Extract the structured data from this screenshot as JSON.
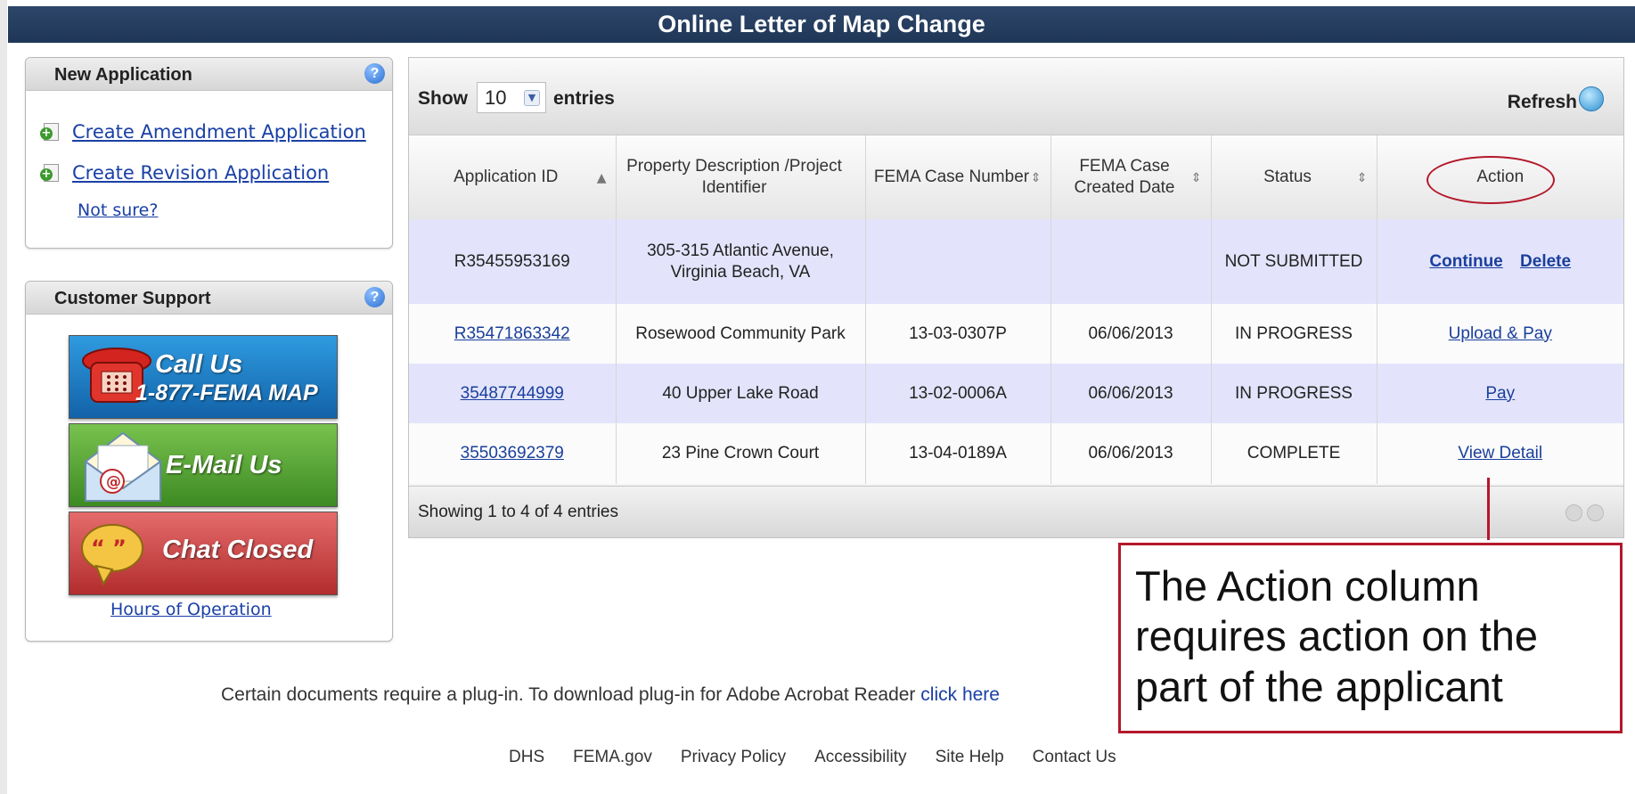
{
  "header": {
    "title": "Online Letter of Map Change"
  },
  "new_application": {
    "title": "New Application",
    "help": "?",
    "links": [
      "Create Amendment Application",
      "Create Revision Application"
    ],
    "not_sure": "Not sure?"
  },
  "customer_support": {
    "title": "Customer Support",
    "help": "?",
    "call_label": "Call Us",
    "call_number": "1-877-FEMA MAP",
    "email_label": "E-Mail Us",
    "chat_label": "Chat Closed",
    "hours_link": "Hours of Operation"
  },
  "grid": {
    "show_label": "Show",
    "entries_value": "10",
    "entries_label": "entries",
    "refresh_label": "Refresh",
    "columns": [
      "Application ID",
      "Property Description /Project Identifier",
      "FEMA Case Number",
      "FEMA Case Created Date",
      "Status",
      "Action"
    ],
    "rows": [
      {
        "id": "R35455953169",
        "property": "305-315 Atlantic Avenue, Virginia Beach, VA",
        "case_number": "",
        "created": "",
        "status": "NOT SUBMITTED",
        "actions": [
          "Continue",
          "Delete"
        ]
      },
      {
        "id": "R35471863342",
        "property": "Rosewood Community Park",
        "case_number": "13-03-0307P",
        "created": "06/06/2013",
        "status": "IN PROGRESS",
        "actions": [
          "Upload & Pay"
        ]
      },
      {
        "id": "35487744999",
        "property": "40 Upper Lake Road",
        "case_number": "13-02-0006A",
        "created": "06/06/2013",
        "status": "IN PROGRESS",
        "actions": [
          "Pay"
        ]
      },
      {
        "id": "35503692379",
        "property": "23 Pine Crown Court",
        "case_number": "13-04-0189A",
        "created": "06/06/2013",
        "status": "COMPLETE",
        "actions": [
          "View Detail"
        ]
      }
    ],
    "footer_info": "Showing 1 to 4 of 4 entries"
  },
  "annotation": {
    "callout_text": "The Action column requires action on the part of the applicant",
    "accent_color": "#b4182b"
  },
  "plugin_notice": {
    "text": "Certain documents require a plug-in. To download plug-in for Adobe Acrobat Reader",
    "link": "click here"
  },
  "footer_links": [
    "DHS",
    "FEMA.gov",
    "Privacy Policy",
    "Accessibility",
    "Site Help",
    "Contact Us"
  ]
}
